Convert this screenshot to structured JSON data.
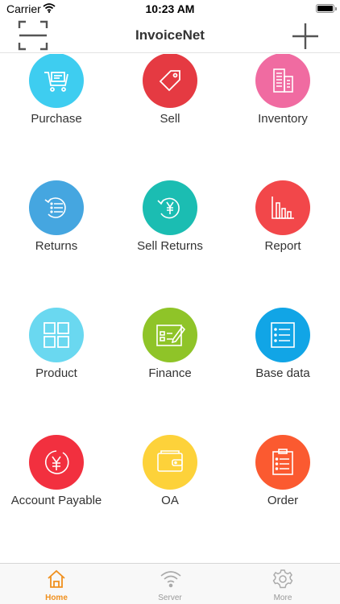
{
  "status_bar": {
    "carrier": "Carrier",
    "time": "10:23 AM"
  },
  "nav": {
    "title": "InvoiceNet",
    "left_icon": "scan-icon",
    "right_icon": "plus-icon"
  },
  "menu": [
    {
      "label": "Purchase",
      "icon": "cart-icon",
      "color": "#3ecdf0"
    },
    {
      "label": "Sell",
      "icon": "tag-icon",
      "color": "#e53a42"
    },
    {
      "label": "Inventory",
      "icon": "building-icon",
      "color": "#f06ba1"
    },
    {
      "label": "Returns",
      "icon": "return-list-icon",
      "color": "#45a6e0"
    },
    {
      "label": "Sell Returns",
      "icon": "yen-return-icon",
      "color": "#1bbdb2"
    },
    {
      "label": "Report",
      "icon": "bar-chart-icon",
      "color": "#f2474a"
    },
    {
      "label": "Product",
      "icon": "grid-icon",
      "color": "#6ad8f0"
    },
    {
      "label": "Finance",
      "icon": "ledger-pen-icon",
      "color": "#8fc428"
    },
    {
      "label": "Base data",
      "icon": "list-doc-icon",
      "color": "#11a5e6"
    },
    {
      "label": "Account Payable",
      "icon": "yen-circle-icon",
      "color": "#f2303f"
    },
    {
      "label": "OA",
      "icon": "wallet-icon",
      "color": "#fdd23a"
    },
    {
      "label": "Order",
      "icon": "clipboard-icon",
      "color": "#fb5a30"
    }
  ],
  "tabs": [
    {
      "label": "Home",
      "icon": "home-icon",
      "active": true
    },
    {
      "label": "Server",
      "icon": "wifi-icon",
      "active": false
    },
    {
      "label": "More",
      "icon": "gear-icon",
      "active": false
    }
  ],
  "colors": {
    "accent": "#f0901e",
    "inactive": "#999999",
    "divider": "#e2e2e2"
  }
}
